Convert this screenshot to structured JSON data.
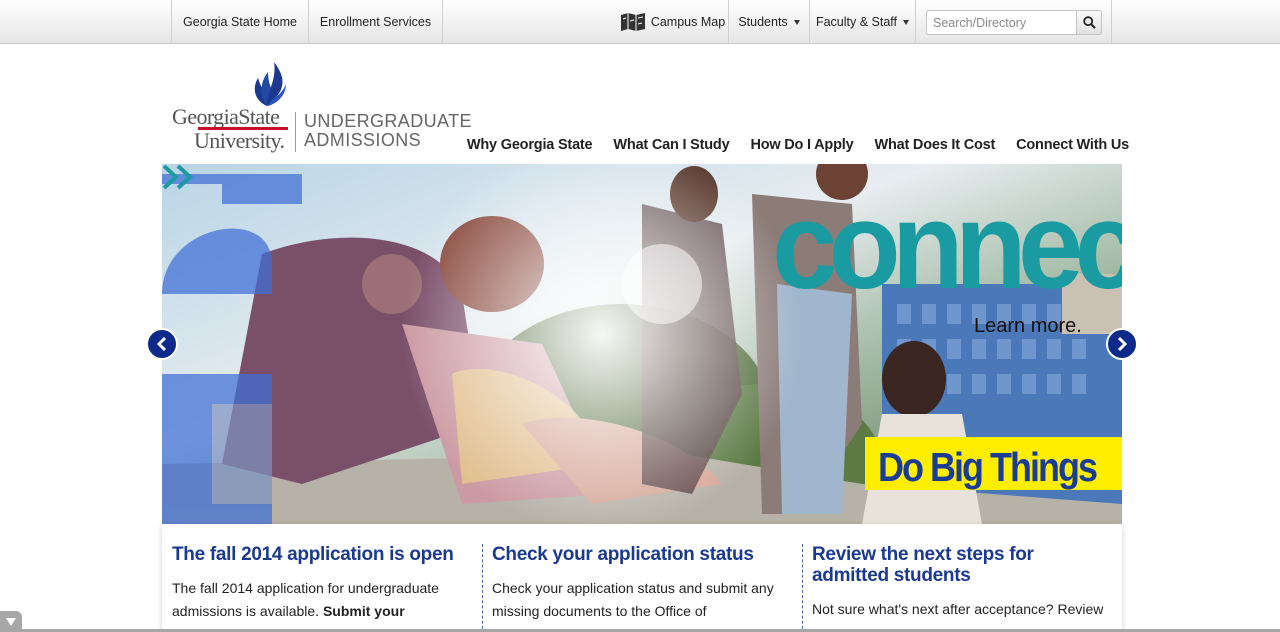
{
  "topbar": {
    "links": [
      "Georgia State Home",
      "Enrollment Services"
    ],
    "campus_map": "Campus Map",
    "students": "Students",
    "faculty_staff": "Faculty & Staff",
    "search_placeholder": "Search/Directory"
  },
  "logo": {
    "line1": "GeorgiaState",
    "line2": "University.",
    "admissions_line1": "UNDERGRADUATE",
    "admissions_line2": "ADMISSIONS"
  },
  "nav": [
    "Why Georgia State",
    "What Can I Study",
    "How Do I Apply",
    "What Does It Cost",
    "Connect With Us"
  ],
  "hero": {
    "headline": "connect",
    "cta": "Learn more.",
    "tagline": "Do Big Things"
  },
  "columns": [
    {
      "title": "The fall 2014 application is open",
      "text": "The fall 2014 application for undergraduate admissions is available. ",
      "link": "Submit your application"
    },
    {
      "title": "Check your application status",
      "text": "Check your application status and submit any missing documents to the Office of"
    },
    {
      "title": "Review the next steps for admitted students",
      "text": "Not sure what's next after acceptance? Review"
    }
  ],
  "colors": {
    "brand_blue": "#1b3a8f",
    "teal": "#1a9aa1",
    "yellow": "#ffee00",
    "red": "#c8102e"
  }
}
